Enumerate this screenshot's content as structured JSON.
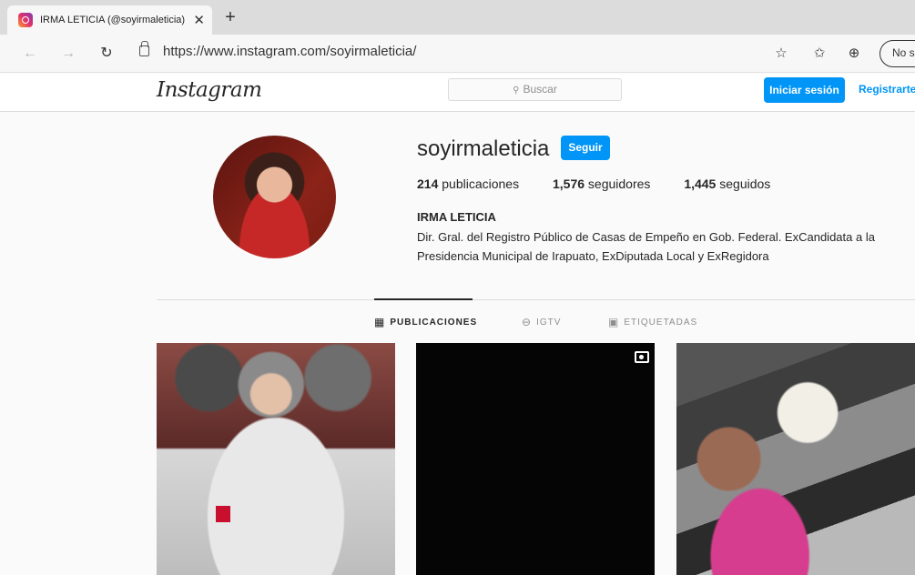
{
  "browser": {
    "tab_title": "IRMA LETICIA (@soyirmaleticia) •",
    "tab_close": "✕",
    "new_tab": "+",
    "url": "https://www.instagram.com/soyirmaleticia/",
    "sync_label": "No se"
  },
  "icons": {
    "back": "←",
    "forward": "→",
    "reload": "↻",
    "favorite": "☆",
    "favorites_bar": "✩",
    "collections": "⊕",
    "search": "⚲",
    "posts_tab": "▦",
    "igtv_tab": "⊖",
    "tagged_tab": "▣"
  },
  "header": {
    "logo": "Instagram",
    "search_placeholder": "Buscar",
    "login_label": "Iniciar sesión",
    "register_label": "Registrarte"
  },
  "profile": {
    "username": "soyirmaleticia",
    "follow_label": "Seguir",
    "posts_count": "214",
    "posts_label": "publicaciones",
    "followers_count": "1,576",
    "followers_label": "seguidores",
    "following_count": "1,445",
    "following_label": "seguidos",
    "full_name": "IRMA LETICIA",
    "bio": "Dir. Gral. del Registro Público de Casas de Empeño en Gob. Federal. ExCandidata a la Presidencia Municipal de Irapuato, ExDiputada Local y ExRegidora"
  },
  "tabs": [
    {
      "label": "PUBLICACIONES",
      "active": true
    },
    {
      "label": "IGTV",
      "active": false
    },
    {
      "label": "ETIQUETADAS",
      "active": false
    }
  ],
  "colors": {
    "accent": "#0095f6",
    "text": "#262626",
    "muted": "#8e8e8e",
    "border": "#dbdbdb"
  }
}
